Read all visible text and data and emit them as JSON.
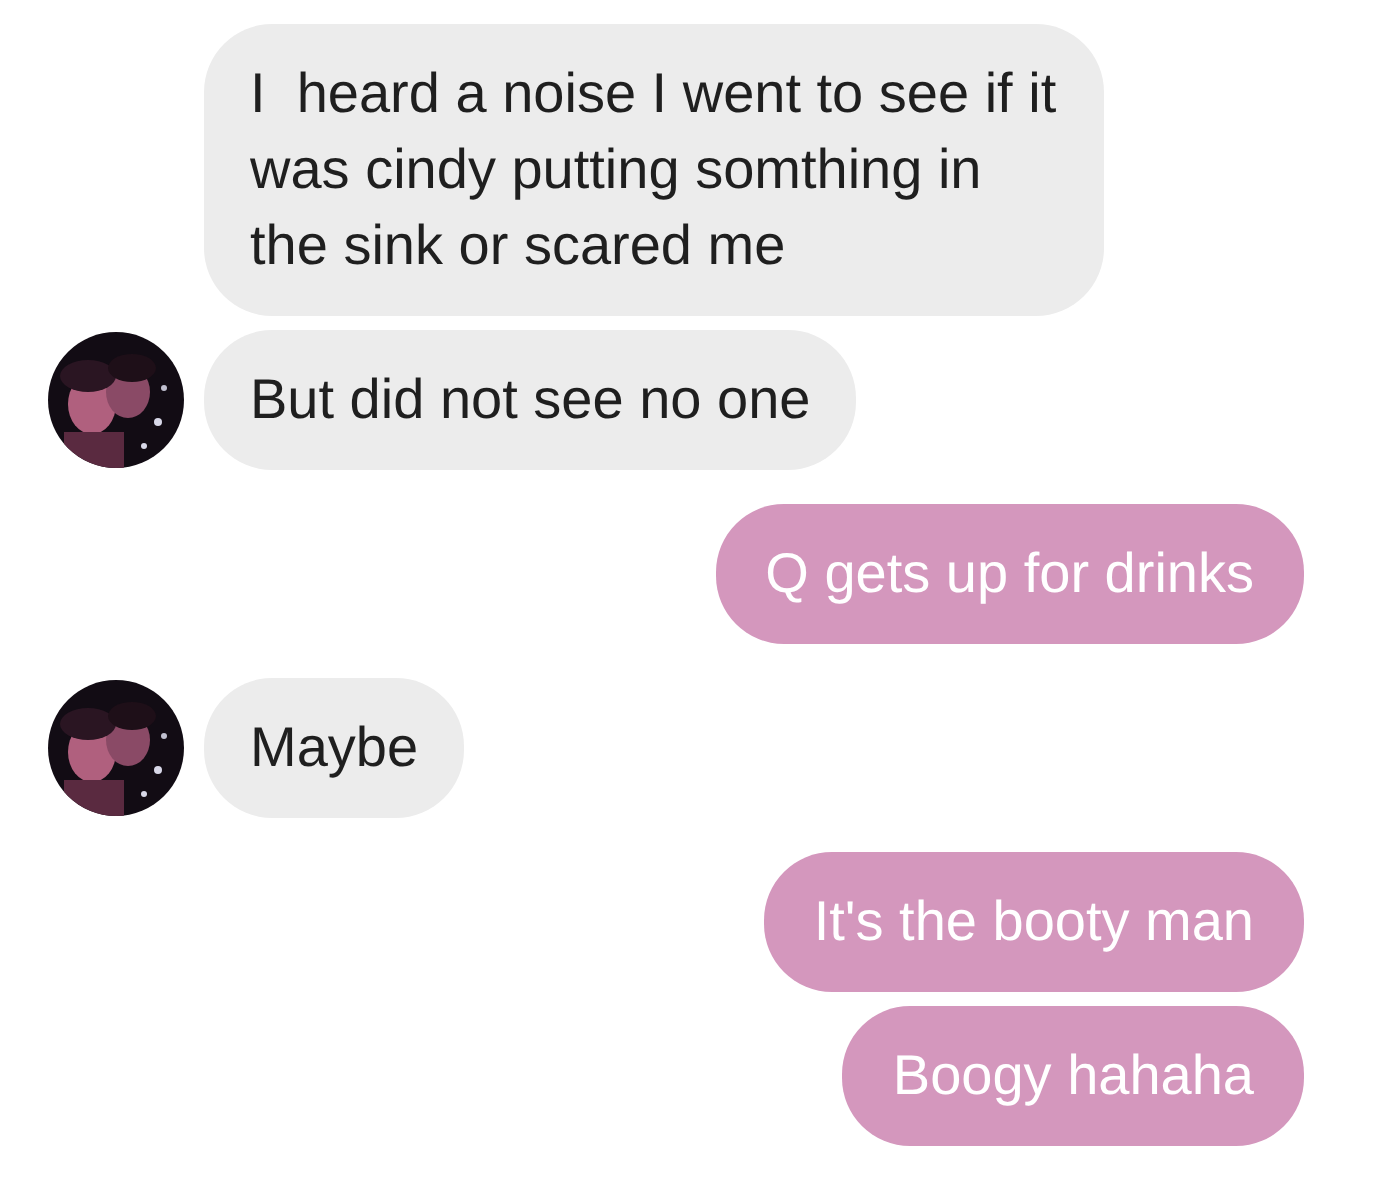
{
  "messages": [
    {
      "kind": "incoming",
      "text": "I  heard a noise I went to see if it was cindy putting somthing in the sink or scared me",
      "avatar": false
    },
    {
      "kind": "incoming",
      "text": "But did not see no one",
      "avatar": true
    },
    {
      "kind": "outgoing",
      "text": "Q gets up for drinks"
    },
    {
      "kind": "incoming",
      "text": "Maybe",
      "avatar": true
    },
    {
      "kind": "outgoing",
      "text": "It's the booty man"
    },
    {
      "kind": "outgoing",
      "text": "Boogy hahaha"
    }
  ]
}
